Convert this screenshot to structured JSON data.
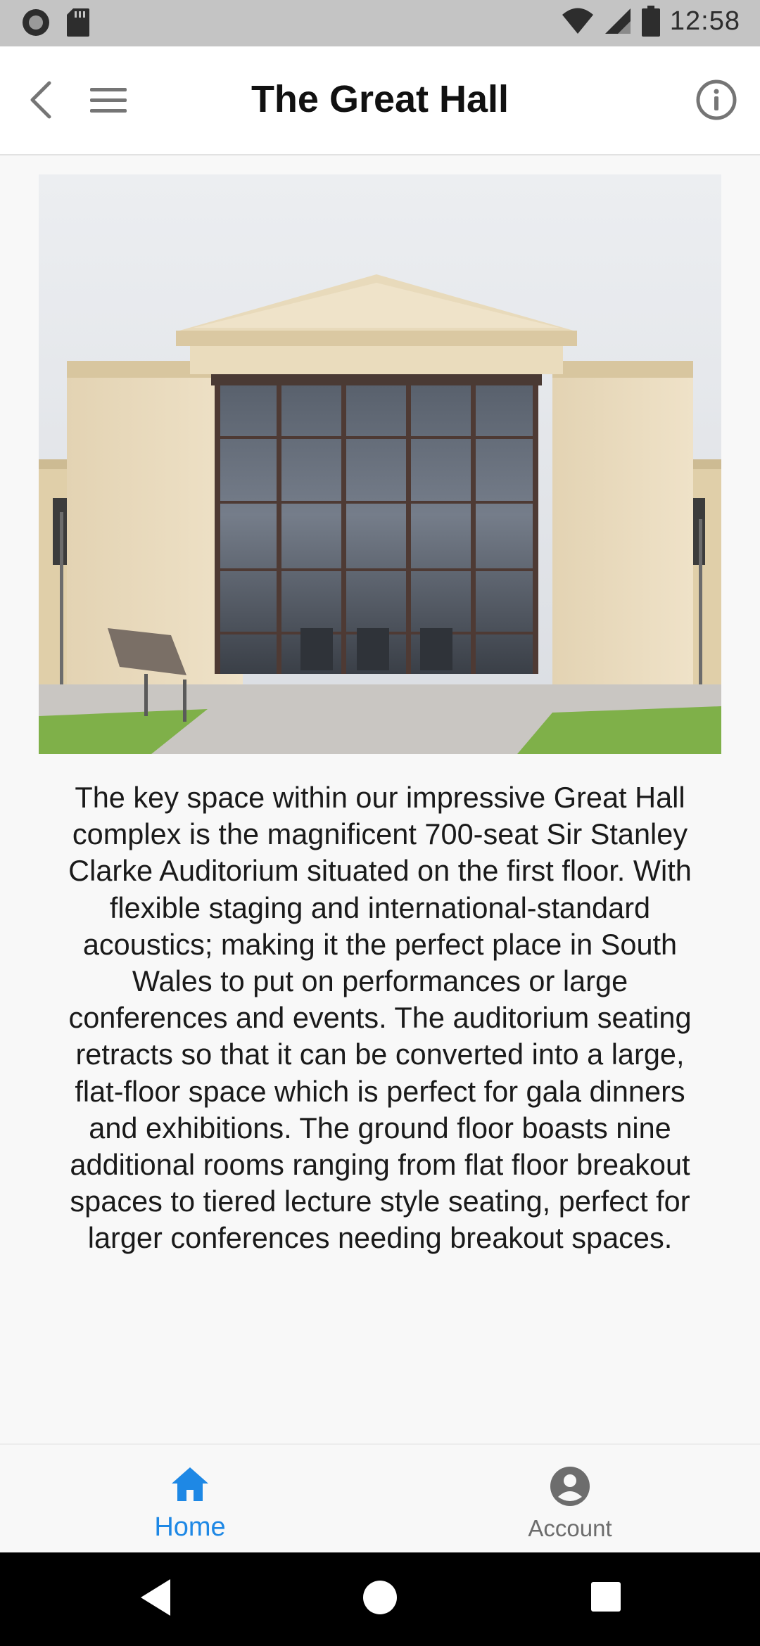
{
  "status_bar": {
    "time": "12:58",
    "icons": [
      "record-icon",
      "sd-card-icon",
      "wifi-icon",
      "cell-signal-icon",
      "battery-icon"
    ]
  },
  "app_bar": {
    "title": "The Great Hall",
    "icons": [
      "back-arrow-icon",
      "hamburger-menu-icon",
      "info-icon"
    ]
  },
  "content": {
    "description": "The key space within our impressive Great Hall complex is the magnificent 700-seat Sir Stanley Clarke Auditorium situated on the first floor. With flexible staging and international-standard acoustics; making it the perfect place in South Wales to put on performances or large conferences and events. The auditorium seating retracts so that it can be converted into a large, flat-floor space which is perfect for gala dinners and exhibitions. The ground floor boasts nine additional rooms ranging from flat floor breakout spaces to tiered lecture style seating, perfect for larger conferences needing breakout spaces."
  },
  "bottom_nav": {
    "items": [
      {
        "label": "Home",
        "icon": "home-icon",
        "active": true
      },
      {
        "label": "Account",
        "icon": "account-icon",
        "active": false
      }
    ]
  },
  "system_nav": {
    "icons": [
      "system-back-icon",
      "system-home-icon",
      "system-recents-icon"
    ]
  },
  "colors": {
    "accent": "#1e88e5",
    "status_bar": "#c4c4c4",
    "app_bar": "#ffffff",
    "background": "#f8f8f8",
    "inactive_nav": "#6d6d6d"
  }
}
